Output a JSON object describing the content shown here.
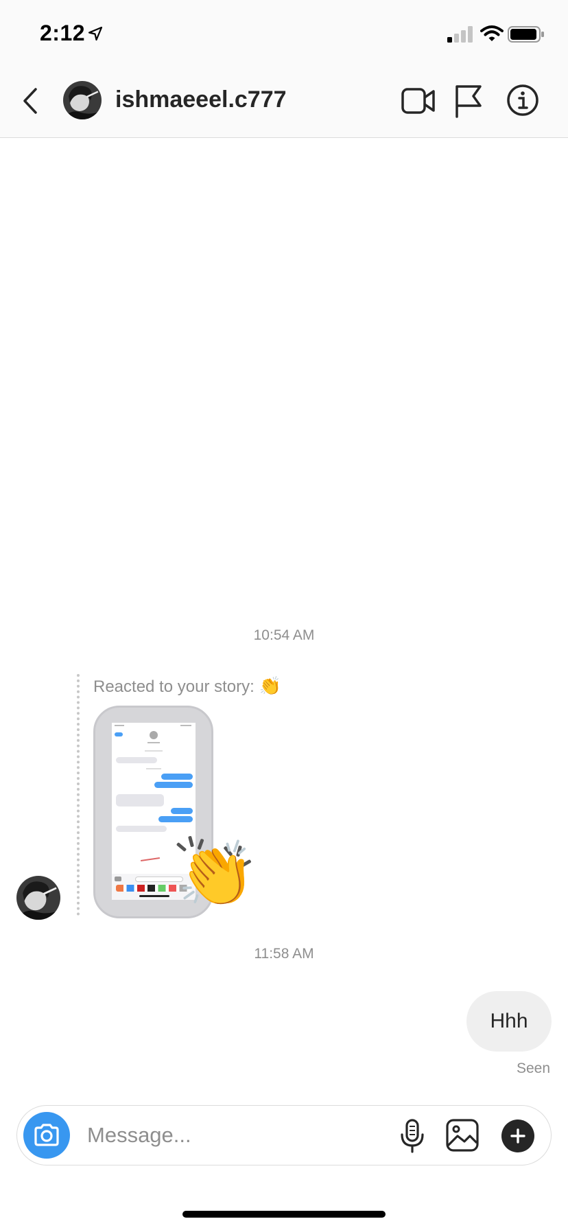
{
  "status_bar": {
    "time": "2:12",
    "icons": [
      "location-arrow-icon",
      "cellular-signal-icon",
      "wifi-icon",
      "battery-icon"
    ]
  },
  "header": {
    "username": "ishmaeeel.c777",
    "icons": [
      "back-chevron-icon",
      "video-camera-icon",
      "flag-icon",
      "info-icon"
    ]
  },
  "thread": {
    "timestamp_1": "10:54 AM",
    "reaction_label": "Reacted to your story:",
    "reaction_emoji": "👏",
    "timestamp_2": "11:58 AM",
    "sent_message": "Hhh",
    "seen_label": "Seen"
  },
  "composer": {
    "placeholder": "Message...",
    "value": "",
    "icons": [
      "camera-icon",
      "microphone-icon",
      "gallery-icon",
      "plus-icon"
    ]
  },
  "colors": {
    "accent_blue": "#3897f0",
    "header_bg": "#fafafa",
    "bubble_bg": "#efefef",
    "muted_text": "#8e8e8e"
  }
}
